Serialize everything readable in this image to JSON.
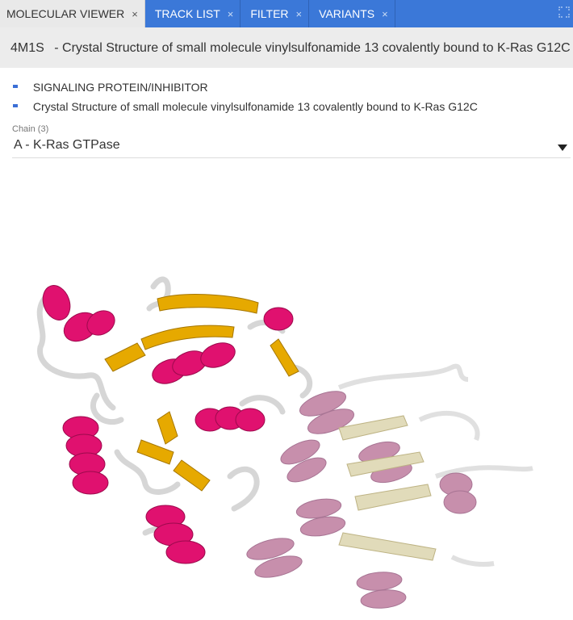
{
  "tabs": [
    {
      "label": "MOLECULAR VIEWER",
      "active": true
    },
    {
      "label": "TRACK LIST",
      "active": false
    },
    {
      "label": "FILTER",
      "active": false
    },
    {
      "label": "VARIANTS",
      "active": false
    }
  ],
  "tab_close_glyph": "×",
  "structure": {
    "pdb_id": "4M1S",
    "title": "- Crystal Structure of small molecule vinylsulfonamide 13 covalently bound to K-Ras G12C"
  },
  "descriptions": [
    "SIGNALING PROTEIN/INHIBITOR",
    "Crystal Structure of small molecule vinylsulfonamide 13 covalently bound to K-Ras G12C"
  ],
  "chain": {
    "label": "Chain (3)",
    "selected": "A - K-Ras GTPase"
  },
  "colors": {
    "tab_bar": "#3b78d8",
    "helix": "#e0116f",
    "sheet": "#e6a900",
    "coil": "#d6d6d6",
    "helix_faded": "#b56a91",
    "sheet_faded": "#d8cfa3"
  }
}
